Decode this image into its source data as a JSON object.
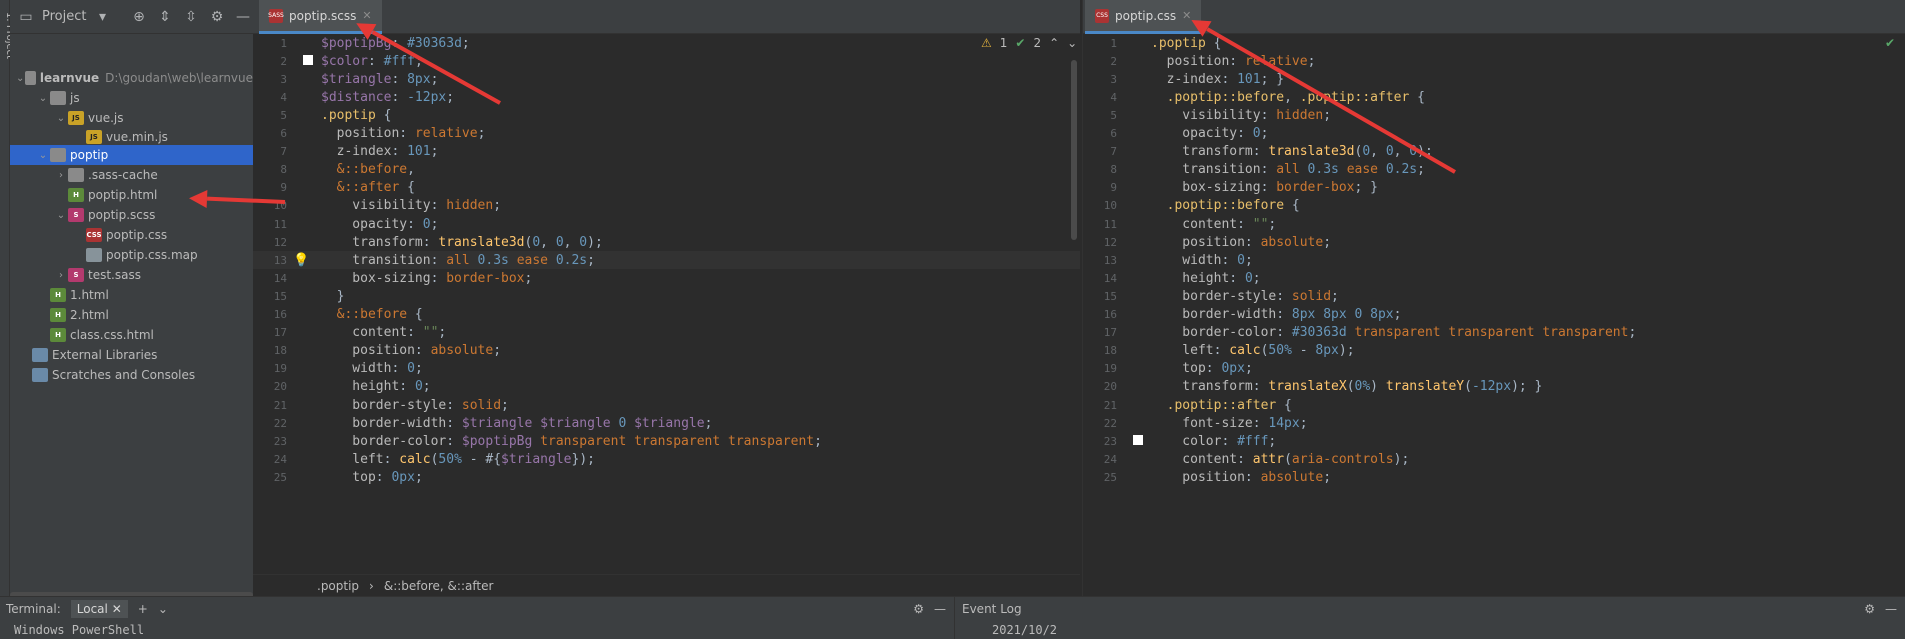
{
  "sidebar_strip": {
    "label": "1: Project"
  },
  "project": {
    "title": "Project",
    "tree": [
      {
        "label": "learnvue",
        "path": "D:\\goudan\\web\\learnvue",
        "icon": "folder-icon",
        "type": "folder",
        "expanded": true,
        "depth": 0
      },
      {
        "label": "js",
        "icon": "folder-icon",
        "type": "folder",
        "expanded": true,
        "depth": 1
      },
      {
        "label": "vue.js",
        "icon": "js-file-icon",
        "type": "js",
        "expanded": true,
        "depth": 2
      },
      {
        "label": "vue.min.js",
        "icon": "js-file-icon",
        "type": "js",
        "depth": 3
      },
      {
        "label": "poptip",
        "icon": "folder-icon",
        "type": "folder",
        "expanded": true,
        "depth": 1,
        "selected": true
      },
      {
        "label": ".sass-cache",
        "icon": "folder-icon",
        "type": "folder",
        "expanded": false,
        "depth": 2
      },
      {
        "label": "poptip.html",
        "icon": "html-file-icon",
        "type": "html",
        "depth": 2
      },
      {
        "label": "poptip.scss",
        "icon": "sass-file-icon",
        "type": "sass",
        "expanded": true,
        "depth": 2
      },
      {
        "label": "poptip.css",
        "icon": "css-file-icon",
        "type": "css",
        "depth": 3
      },
      {
        "label": "poptip.css.map",
        "icon": "file-icon",
        "type": "file",
        "depth": 3
      },
      {
        "label": "test.sass",
        "icon": "sass-file-icon",
        "type": "sass",
        "expanded": false,
        "depth": 2
      },
      {
        "label": "1.html",
        "icon": "html-file-icon",
        "type": "html",
        "depth": 1
      },
      {
        "label": "2.html",
        "icon": "html-file-icon",
        "type": "html",
        "depth": 1
      },
      {
        "label": "class.css.html",
        "icon": "html-file-icon",
        "type": "html",
        "depth": 1
      },
      {
        "label": "External Libraries",
        "icon": "library-icon",
        "type": "lib",
        "depth": 0
      },
      {
        "label": "Scratches and Consoles",
        "icon": "scratches-icon",
        "type": "lib",
        "depth": 0
      }
    ]
  },
  "left_editor": {
    "tab": "poptip.scss",
    "tab_icon": "SASS",
    "warnings": "1",
    "checks": "2",
    "current_line": 13,
    "breadcrumb": [
      ".poptip",
      "&::before, &::after"
    ],
    "lines": [
      [
        [
          "var",
          "$poptipBg"
        ],
        [
          "code",
          ": "
        ],
        [
          "num",
          "#30363d"
        ],
        [
          "code",
          ";"
        ]
      ],
      [
        [
          "var",
          "$color"
        ],
        [
          "code",
          ": "
        ],
        [
          "num",
          "#fff"
        ],
        [
          "code",
          ";"
        ]
      ],
      [
        [
          "var",
          "$triangle"
        ],
        [
          "code",
          ": "
        ],
        [
          "num",
          "8px"
        ],
        [
          "code",
          ";"
        ]
      ],
      [
        [
          "var",
          "$distance"
        ],
        [
          "code",
          ": "
        ],
        [
          "num",
          "-12px"
        ],
        [
          "code",
          ";"
        ]
      ],
      [
        [
          "sel-c",
          ".poptip"
        ],
        [
          "code",
          " {"
        ]
      ],
      [
        [
          "prop",
          "  position"
        ],
        [
          "code",
          ": "
        ],
        [
          "val",
          "relative"
        ],
        [
          "code",
          ";"
        ]
      ],
      [
        [
          "prop",
          "  z-index"
        ],
        [
          "code",
          ": "
        ],
        [
          "num",
          "101"
        ],
        [
          "code",
          ";"
        ]
      ],
      [
        [
          "val",
          "  &::before"
        ],
        [
          "code",
          ","
        ]
      ],
      [
        [
          "val",
          "  &::after"
        ],
        [
          "code",
          " {"
        ]
      ],
      [
        [
          "prop",
          "    visibility"
        ],
        [
          "code",
          ": "
        ],
        [
          "val",
          "hidden"
        ],
        [
          "code",
          ";"
        ]
      ],
      [
        [
          "prop",
          "    opacity"
        ],
        [
          "code",
          ": "
        ],
        [
          "num",
          "0"
        ],
        [
          "code",
          ";"
        ]
      ],
      [
        [
          "prop",
          "    transform"
        ],
        [
          "code",
          ": "
        ],
        [
          "fn",
          "translate3d"
        ],
        [
          "code",
          "("
        ],
        [
          "num",
          "0"
        ],
        [
          "code",
          ", "
        ],
        [
          "num",
          "0"
        ],
        [
          "code",
          ", "
        ],
        [
          "num",
          "0"
        ],
        [
          "code",
          ");"
        ]
      ],
      [
        [
          "prop",
          "    transition"
        ],
        [
          "code",
          ": "
        ],
        [
          "val",
          "all "
        ],
        [
          "num",
          "0.3s "
        ],
        [
          "val",
          "ease "
        ],
        [
          "num",
          "0.2s"
        ],
        [
          "code",
          ";"
        ]
      ],
      [
        [
          "prop",
          "    box-sizing"
        ],
        [
          "code",
          ": "
        ],
        [
          "val",
          "border-box"
        ],
        [
          "code",
          ";"
        ]
      ],
      [
        [
          "code",
          "  }"
        ]
      ],
      [
        [
          "val",
          "  &::before"
        ],
        [
          "code",
          " {"
        ]
      ],
      [
        [
          "prop",
          "    content"
        ],
        [
          "code",
          ": "
        ],
        [
          "str",
          "\"\""
        ],
        [
          "code",
          ";"
        ]
      ],
      [
        [
          "prop",
          "    position"
        ],
        [
          "code",
          ": "
        ],
        [
          "val",
          "absolute"
        ],
        [
          "code",
          ";"
        ]
      ],
      [
        [
          "prop",
          "    width"
        ],
        [
          "code",
          ": "
        ],
        [
          "num",
          "0"
        ],
        [
          "code",
          ";"
        ]
      ],
      [
        [
          "prop",
          "    height"
        ],
        [
          "code",
          ": "
        ],
        [
          "num",
          "0"
        ],
        [
          "code",
          ";"
        ]
      ],
      [
        [
          "prop",
          "    border-style"
        ],
        [
          "code",
          ": "
        ],
        [
          "val",
          "solid"
        ],
        [
          "code",
          ";"
        ]
      ],
      [
        [
          "prop",
          "    border-width"
        ],
        [
          "code",
          ": "
        ],
        [
          "var",
          "$triangle "
        ],
        [
          "var",
          "$triangle "
        ],
        [
          "num",
          "0 "
        ],
        [
          "var",
          "$triangle"
        ],
        [
          "code",
          ";"
        ]
      ],
      [
        [
          "prop",
          "    border-color"
        ],
        [
          "code",
          ": "
        ],
        [
          "var",
          "$poptipBg "
        ],
        [
          "val",
          "transparent transparent transparent"
        ],
        [
          "code",
          ";"
        ]
      ],
      [
        [
          "prop",
          "    left"
        ],
        [
          "code",
          ": "
        ],
        [
          "fn",
          "calc"
        ],
        [
          "code",
          "("
        ],
        [
          "num",
          "50%"
        ],
        [
          "code",
          " - #{"
        ],
        [
          "var",
          "$triangle"
        ],
        [
          "code",
          "});"
        ]
      ],
      [
        [
          "prop",
          "    top"
        ],
        [
          "code",
          ": "
        ],
        [
          "num",
          "0px"
        ],
        [
          "code",
          ";"
        ]
      ]
    ]
  },
  "right_editor": {
    "tab": "poptip.css",
    "tab_icon": "CSS",
    "lines": [
      [
        [
          "sel-c",
          ".poptip"
        ],
        [
          "code",
          " {"
        ]
      ],
      [
        [
          "prop",
          "  position"
        ],
        [
          "code",
          ": "
        ],
        [
          "val",
          "relative"
        ],
        [
          "code",
          ";"
        ]
      ],
      [
        [
          "prop",
          "  z-index"
        ],
        [
          "code",
          ": "
        ],
        [
          "num",
          "101"
        ],
        [
          "code",
          "; }"
        ]
      ],
      [
        [
          "sel-c",
          "  .poptip::before"
        ],
        [
          "code",
          ", "
        ],
        [
          "sel-c",
          ".poptip::after"
        ],
        [
          "code",
          " {"
        ]
      ],
      [
        [
          "prop",
          "    visibility"
        ],
        [
          "code",
          ": "
        ],
        [
          "val",
          "hidden"
        ],
        [
          "code",
          ";"
        ]
      ],
      [
        [
          "prop",
          "    opacity"
        ],
        [
          "code",
          ": "
        ],
        [
          "num",
          "0"
        ],
        [
          "code",
          ";"
        ]
      ],
      [
        [
          "prop",
          "    transform"
        ],
        [
          "code",
          ": "
        ],
        [
          "fn",
          "translate3d"
        ],
        [
          "code",
          "("
        ],
        [
          "num",
          "0"
        ],
        [
          "code",
          ", "
        ],
        [
          "num",
          "0"
        ],
        [
          "code",
          ", "
        ],
        [
          "num",
          "0"
        ],
        [
          "code",
          ");"
        ]
      ],
      [
        [
          "prop",
          "    transition"
        ],
        [
          "code",
          ": "
        ],
        [
          "val",
          "all "
        ],
        [
          "num",
          "0.3s "
        ],
        [
          "val",
          "ease "
        ],
        [
          "num",
          "0.2s"
        ],
        [
          "code",
          ";"
        ]
      ],
      [
        [
          "prop",
          "    box-sizing"
        ],
        [
          "code",
          ": "
        ],
        [
          "val",
          "border-box"
        ],
        [
          "code",
          "; }"
        ]
      ],
      [
        [
          "sel-c",
          "  .poptip::before"
        ],
        [
          "code",
          " {"
        ]
      ],
      [
        [
          "prop",
          "    content"
        ],
        [
          "code",
          ": "
        ],
        [
          "str",
          "\"\""
        ],
        [
          "code",
          ";"
        ]
      ],
      [
        [
          "prop",
          "    position"
        ],
        [
          "code",
          ": "
        ],
        [
          "val",
          "absolute"
        ],
        [
          "code",
          ";"
        ]
      ],
      [
        [
          "prop",
          "    width"
        ],
        [
          "code",
          ": "
        ],
        [
          "num",
          "0"
        ],
        [
          "code",
          ";"
        ]
      ],
      [
        [
          "prop",
          "    height"
        ],
        [
          "code",
          ": "
        ],
        [
          "num",
          "0"
        ],
        [
          "code",
          ";"
        ]
      ],
      [
        [
          "prop",
          "    border-style"
        ],
        [
          "code",
          ": "
        ],
        [
          "val",
          "solid"
        ],
        [
          "code",
          ";"
        ]
      ],
      [
        [
          "prop",
          "    border-width"
        ],
        [
          "code",
          ": "
        ],
        [
          "num",
          "8px 8px 0 8px"
        ],
        [
          "code",
          ";"
        ]
      ],
      [
        [
          "prop",
          "    border-color"
        ],
        [
          "code",
          ": "
        ],
        [
          "num",
          "#30363d "
        ],
        [
          "val",
          "transparent transparent transparent"
        ],
        [
          "code",
          ";"
        ]
      ],
      [
        [
          "prop",
          "    left"
        ],
        [
          "code",
          ": "
        ],
        [
          "fn",
          "calc"
        ],
        [
          "code",
          "("
        ],
        [
          "num",
          "50%"
        ],
        [
          "code",
          " - "
        ],
        [
          "num",
          "8px"
        ],
        [
          "code",
          ");"
        ]
      ],
      [
        [
          "prop",
          "    top"
        ],
        [
          "code",
          ": "
        ],
        [
          "num",
          "0px"
        ],
        [
          "code",
          ";"
        ]
      ],
      [
        [
          "prop",
          "    transform"
        ],
        [
          "code",
          ": "
        ],
        [
          "fn",
          "translateX"
        ],
        [
          "code",
          "("
        ],
        [
          "num",
          "0%"
        ],
        [
          "code",
          ") "
        ],
        [
          "fn",
          "translateY"
        ],
        [
          "code",
          "("
        ],
        [
          "num",
          "-12px"
        ],
        [
          "code",
          "); }"
        ]
      ],
      [
        [
          "sel-c",
          "  .poptip::after"
        ],
        [
          "code",
          " {"
        ]
      ],
      [
        [
          "prop",
          "    font-size"
        ],
        [
          "code",
          ": "
        ],
        [
          "num",
          "14px"
        ],
        [
          "code",
          ";"
        ]
      ],
      [
        [
          "prop",
          "    color"
        ],
        [
          "code",
          ": "
        ],
        [
          "num",
          "#fff"
        ],
        [
          "code",
          ";"
        ]
      ],
      [
        [
          "prop",
          "    content"
        ],
        [
          "code",
          ": "
        ],
        [
          "fn",
          "attr"
        ],
        [
          "code",
          "("
        ],
        [
          "val",
          "aria-controls"
        ],
        [
          "code",
          ");"
        ]
      ],
      [
        [
          "prop",
          "    position"
        ],
        [
          "code",
          ": "
        ],
        [
          "val",
          "absolute"
        ],
        [
          "code",
          ";"
        ]
      ]
    ]
  },
  "terminal": {
    "title": "Terminal:",
    "tab": "Local",
    "content": "Windows PowerShell"
  },
  "event_log": {
    "title": "Event Log",
    "content": "2021/10/2"
  },
  "colors": {
    "accent": "#2f65ca",
    "annotation": "#e53935"
  }
}
